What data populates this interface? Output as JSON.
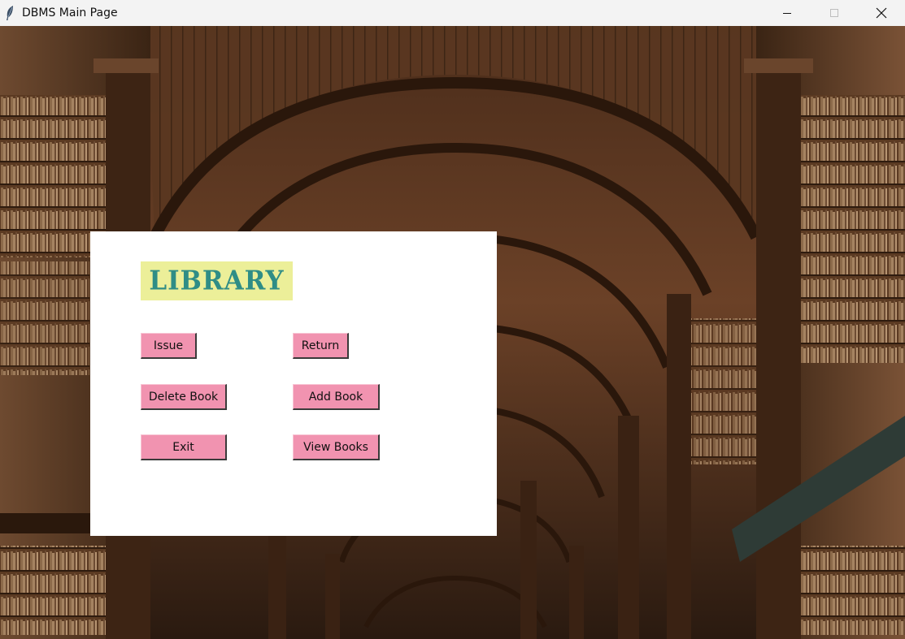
{
  "window": {
    "title": "DBMS Main Page",
    "controls": {
      "minimize_icon": "minimize-icon",
      "maximize_icon": "maximize-icon",
      "close_icon": "close-icon"
    }
  },
  "panel": {
    "heading": "LIBRARY",
    "heading_bg": "#ecef99",
    "heading_color": "#2f8d86",
    "button_color": "#f193b0",
    "buttons": {
      "issue": "Issue",
      "return": "Return",
      "delete_book": "Delete Book",
      "add_book": "Add Book",
      "exit": "Exit",
      "view_books": "View Books"
    }
  }
}
